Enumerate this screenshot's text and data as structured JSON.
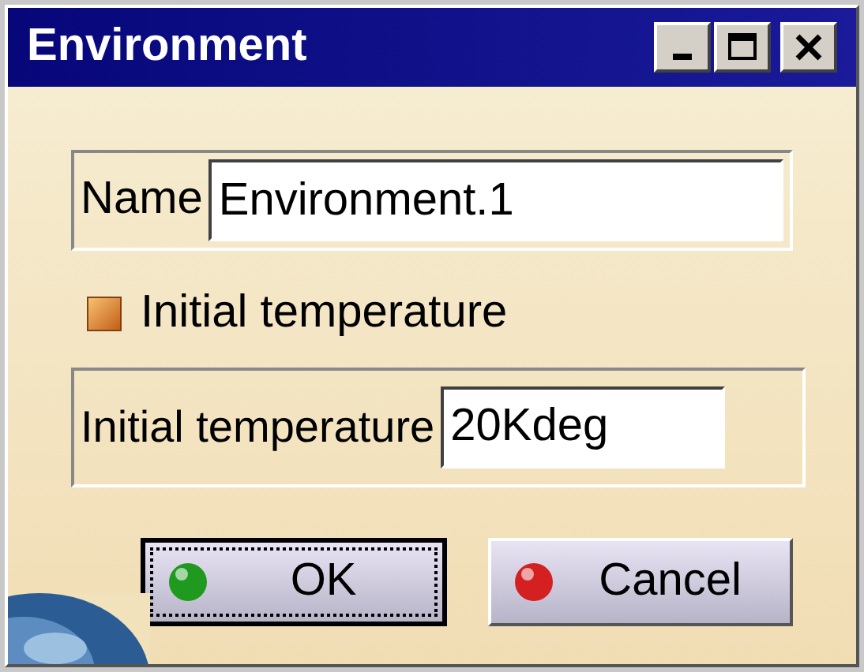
{
  "window": {
    "title": "Environment",
    "controls": [
      {
        "kind": "minimize"
      },
      {
        "kind": "maximize"
      },
      {
        "kind": "close"
      }
    ]
  },
  "name_field": {
    "label": "Name",
    "value": "Environment.1"
  },
  "checkbox": {
    "label": "Initial temperature",
    "checked": true
  },
  "temperature_field": {
    "label": "Initial temperature",
    "value": "20Kdeg"
  },
  "buttons": [
    {
      "label": "OK",
      "color": "#1f9a1f",
      "focused": true
    },
    {
      "label": "Cancel",
      "color": "#d42020",
      "focused": false
    }
  ]
}
